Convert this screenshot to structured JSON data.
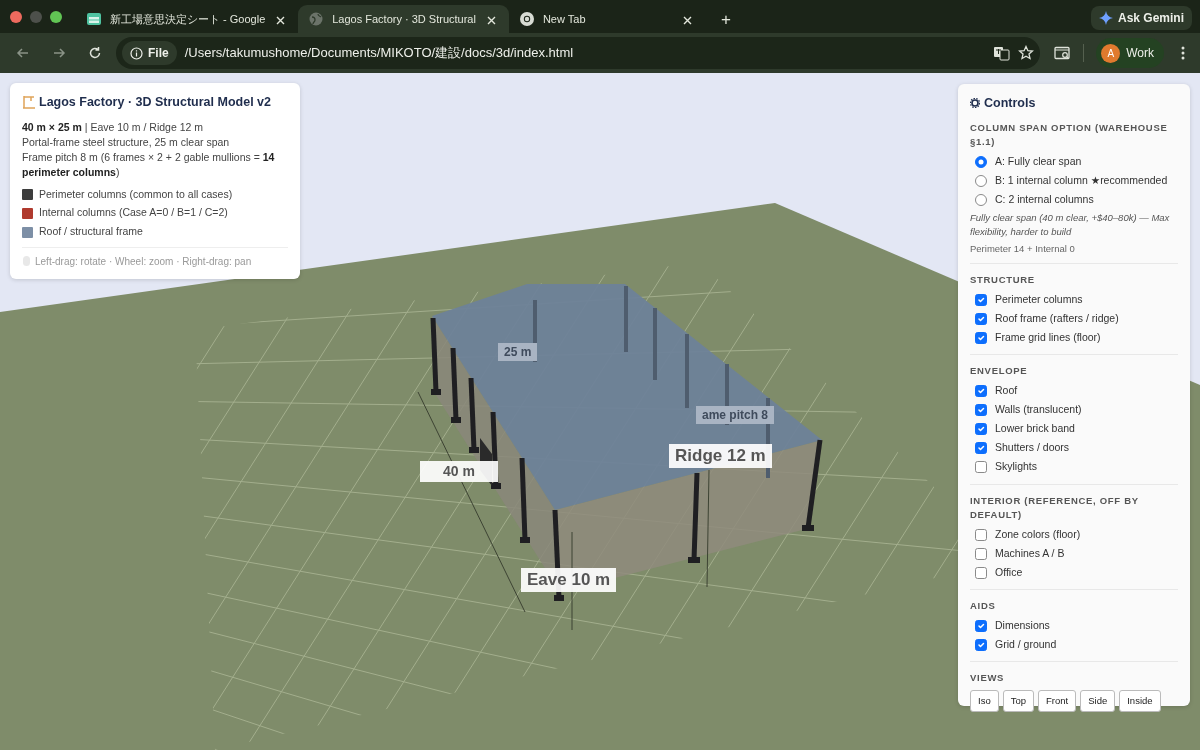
{
  "browser": {
    "tabs": [
      {
        "title": "新工場意思決定シート - Google",
        "selected": false
      },
      {
        "title": "Lagos Factory · 3D Structural",
        "selected": true
      },
      {
        "title": "New Tab",
        "selected": false
      }
    ],
    "new_tab": "+",
    "assistant_button": "Ask Gemini",
    "address": {
      "chip": "File",
      "url": "/Users/takumushome/Documents/MIKOTO/建設/docs/3d/index.html"
    },
    "profile": {
      "initial": "A",
      "label": "Work"
    }
  },
  "info": {
    "title": "Lagos Factory · 3D Structural Model v2",
    "lines": [
      "**40 m × 25 m** | Eave 10 m / Ridge 12 m",
      "Portal-frame steel structure, 25 m clear span",
      "Frame pitch 8 m (6 frames × 2 + 2 gable mullions = **14 perimeter columns**)"
    ],
    "legend": [
      {
        "label": "Perimeter columns (common to all cases)",
        "color": "#3d3d3d"
      },
      {
        "label": "Internal columns (Case A=0 / B=1 / C=2)",
        "color": "#b03a2e"
      },
      {
        "label": "Roof / structural frame",
        "color": "#7d8fa6"
      }
    ],
    "hint": "Left-drag: rotate · Wheel: zoom · Right-drag: pan"
  },
  "scene": {
    "labels": [
      {
        "text": "25 m",
        "behind_roof": true
      },
      {
        "text": "ame pitch 8",
        "behind_roof": true
      },
      {
        "text": "40 m",
        "behind_roof": false
      },
      {
        "text": "Ridge 12 m",
        "behind_roof": false
      },
      {
        "text": "Eave 10 m",
        "behind_roof": false
      }
    ]
  },
  "controls": {
    "title": "Controls",
    "sections": [
      {
        "heading": "COLUMN SPAN OPTION (WAREHOUSE §1.1)",
        "kind": "radio",
        "items": [
          {
            "label": "A: Fully clear span",
            "selected": true
          },
          {
            "label": "B: 1 internal column ★recommended",
            "selected": false
          },
          {
            "label": "C: 2 internal columns",
            "selected": false
          }
        ],
        "note": "Fully clear span (40 m clear, +$40–80k) — Max flexibility, harder to build",
        "summary": "Perimeter 14 + Internal 0"
      },
      {
        "heading": "STRUCTURE",
        "kind": "check",
        "items": [
          {
            "label": "Perimeter columns",
            "checked": true
          },
          {
            "label": "Roof frame (rafters / ridge)",
            "checked": true
          },
          {
            "label": "Frame grid lines (floor)",
            "checked": true
          }
        ]
      },
      {
        "heading": "ENVELOPE",
        "kind": "check",
        "items": [
          {
            "label": "Roof",
            "checked": true
          },
          {
            "label": "Walls (translucent)",
            "checked": true
          },
          {
            "label": "Lower brick band",
            "checked": true
          },
          {
            "label": "Shutters / doors",
            "checked": true
          },
          {
            "label": "Skylights",
            "checked": false
          }
        ]
      },
      {
        "heading": "INTERIOR (REFERENCE, OFF BY DEFAULT)",
        "kind": "check",
        "items": [
          {
            "label": "Zone colors (floor)",
            "checked": false
          },
          {
            "label": "Machines A / B",
            "checked": false
          },
          {
            "label": "Office",
            "checked": false
          }
        ]
      },
      {
        "heading": "AIDS",
        "kind": "check",
        "items": [
          {
            "label": "Dimensions",
            "checked": true
          },
          {
            "label": "Grid / ground",
            "checked": true
          }
        ]
      },
      {
        "heading": "VIEWS",
        "kind": "buttons",
        "items": [
          {
            "label": "Iso"
          },
          {
            "label": "Top"
          },
          {
            "label": "Front"
          },
          {
            "label": "Side"
          },
          {
            "label": "Inside"
          }
        ]
      }
    ]
  }
}
